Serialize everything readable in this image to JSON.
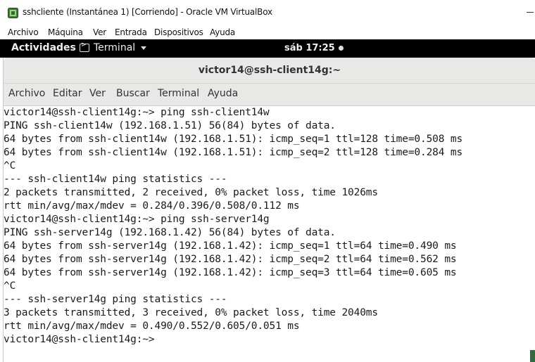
{
  "vbox": {
    "title": "sshcliente (Instantánea 1) [Corriendo] - Oracle VM VirtualBox",
    "menu": [
      "Archivo",
      "Máquina",
      "Ver",
      "Entrada",
      "Dispositivos",
      "Ayuda"
    ]
  },
  "gnome": {
    "activities": "Actividades",
    "app_name": "Terminal",
    "clock": "sáb 17:25"
  },
  "terminal": {
    "title": "victor14@ssh-client14g:~",
    "menu": [
      "Archivo",
      "Editar",
      "Ver",
      "Buscar",
      "Terminal",
      "Ayuda"
    ],
    "lines": [
      "victor14@ssh-client14g:~> ping ssh-client14w",
      "PING ssh-client14w (192.168.1.51) 56(84) bytes of data.",
      "64 bytes from ssh-client14w (192.168.1.51): icmp_seq=1 ttl=128 time=0.508 ms",
      "64 bytes from ssh-client14w (192.168.1.51): icmp_seq=2 ttl=128 time=0.284 ms",
      "^C",
      "--- ssh-client14w ping statistics ---",
      "2 packets transmitted, 2 received, 0% packet loss, time 1026ms",
      "rtt min/avg/max/mdev = 0.284/0.396/0.508/0.112 ms",
      "victor14@ssh-client14g:~> ping ssh-server14g",
      "PING ssh-server14g (192.168.1.42) 56(84) bytes of data.",
      "64 bytes from ssh-server14g (192.168.1.42): icmp_seq=1 ttl=64 time=0.490 ms",
      "64 bytes from ssh-server14g (192.168.1.42): icmp_seq=2 ttl=64 time=0.562 ms",
      "64 bytes from ssh-server14g (192.168.1.42): icmp_seq=3 ttl=64 time=0.605 ms",
      "^C",
      "--- ssh-server14g ping statistics ---",
      "3 packets transmitted, 3 received, 0% packet loss, time 2040ms",
      "rtt min/avg/max/mdev = 0.490/0.552/0.605/0.051 ms",
      "victor14@ssh-client14g:~> "
    ]
  }
}
